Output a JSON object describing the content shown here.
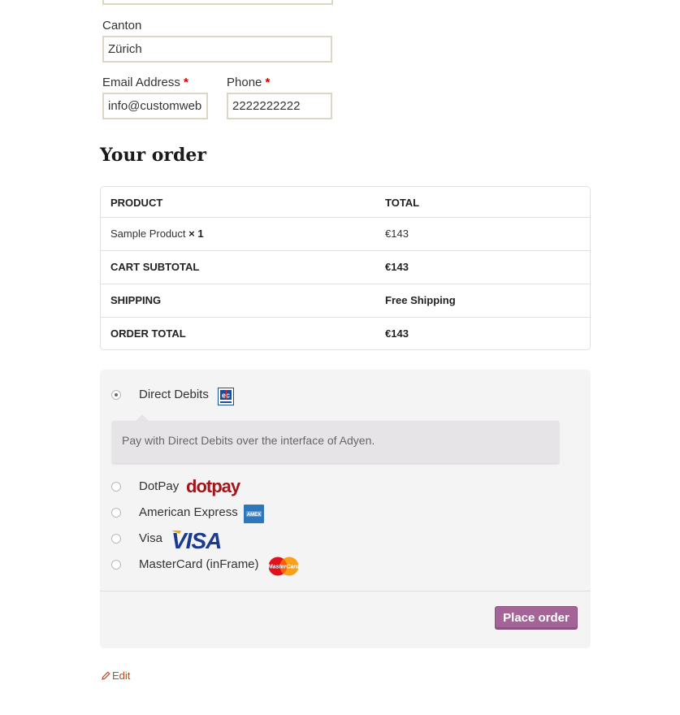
{
  "billing": {
    "canton_label": "Canton",
    "canton_value": "Zürich",
    "email_label": "Email Address",
    "email_value": "info@customweb",
    "phone_label": "Phone",
    "phone_value": "2222222222",
    "required_marker": "*"
  },
  "order": {
    "title": "Your order",
    "header": {
      "product": "PRODUCT",
      "total": "TOTAL"
    },
    "item": {
      "name": "Sample Product",
      "qty": "× 1",
      "total": "€143"
    },
    "subtotal": {
      "label": "CART SUBTOTAL",
      "value": "€143"
    },
    "shipping": {
      "label": "SHIPPING",
      "value": "Free Shipping"
    },
    "total": {
      "label": "ORDER TOTAL",
      "value": "€143"
    }
  },
  "payment": {
    "methods": [
      {
        "label": "Direct Debits",
        "icon": "direct-debit-ec-icon",
        "selected": true
      },
      {
        "label": "DotPay",
        "icon": "dotpay-logo-icon",
        "selected": false
      },
      {
        "label": "American Express",
        "icon": "amex-logo-icon",
        "selected": false
      },
      {
        "label": "Visa",
        "icon": "visa-logo-icon",
        "selected": false
      },
      {
        "label": "MasterCard (inFrame)",
        "icon": "mastercard-logo-icon",
        "selected": false
      }
    ],
    "selected_description": "Pay with Direct Debits over the interface of Adyen.",
    "place_order_label": "Place order",
    "logo_text": {
      "dotpay": "dotpay",
      "visa": "VISA",
      "mastercard": "MasterCard"
    }
  },
  "footer": {
    "edit_label": "Edit"
  },
  "colors": {
    "accent": "#a46497",
    "border": "#dcd7c3",
    "link": "#b74e1d",
    "required": "#cc0000"
  }
}
